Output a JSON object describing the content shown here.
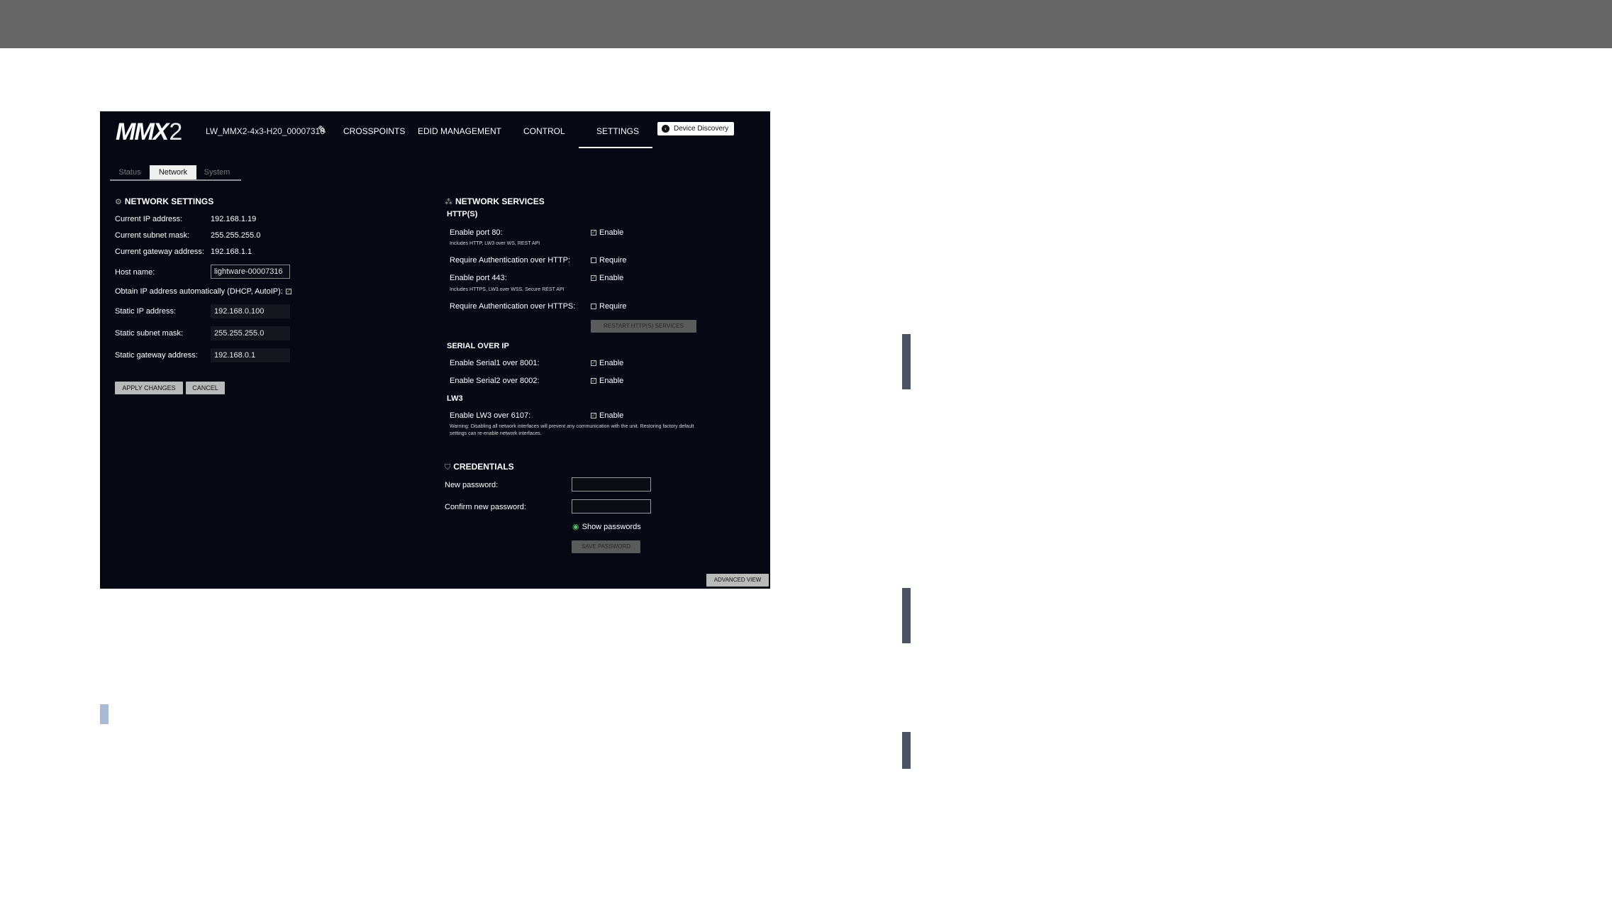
{
  "app": {
    "logo_main": "MMX",
    "logo_suffix": "2",
    "device_name": "LW_MMX2-4x3-H20_00007316",
    "nav": [
      "CROSSPOINTS",
      "EDID MANAGEMENT",
      "CONTROL",
      "SETTINGS"
    ],
    "active_nav": "SETTINGS",
    "device_discovery": "Device Discovery"
  },
  "subtabs": [
    "Status",
    "Network",
    "System"
  ],
  "active_subtab": "Network",
  "network_settings": {
    "title": "NETWORK SETTINGS",
    "current_ip_label": "Current IP address:",
    "current_ip": "192.168.1.19",
    "current_mask_label": "Current subnet mask:",
    "current_mask": "255.255.255.0",
    "current_gw_label": "Current gateway address:",
    "current_gw": "192.168.1.1",
    "hostname_label": "Host name:",
    "hostname": "lightware-00007316",
    "dhcp_label": "Obtain IP address automatically (DHCP, AutoIP):",
    "dhcp_checked": true,
    "static_ip_label": "Static IP address:",
    "static_ip": "192.168.0.100",
    "static_mask_label": "Static subnet mask:",
    "static_mask": "255.255.255.0",
    "static_gw_label": "Static gateway address:",
    "static_gw": "192.168.0.1",
    "apply": "APPLY CHANGES",
    "cancel": "CANCEL"
  },
  "network_services": {
    "title": "NETWORK SERVICES",
    "http_heading": "HTTP(S)",
    "port80_label": "Enable port 80:",
    "port80_note": "Includes HTTP, LW3 over WS, REST API",
    "port80_value": "Enable",
    "auth_http_label": "Require Authentication over HTTP:",
    "auth_http_value": "Require",
    "port443_label": "Enable port 443:",
    "port443_note": "Includes HTTPS, LW3 over WSS, Secure REST API",
    "port443_value": "Enable",
    "auth_https_label": "Require Authentication over HTTPS:",
    "auth_https_value": "Require",
    "restart": "RESTART HTTP(S) SERVICES",
    "serial_heading": "SERIAL OVER IP",
    "serial1_label": "Enable Serial1 over 8001:",
    "serial1_value": "Enable",
    "serial2_label": "Enable Serial2 over 8002:",
    "serial2_value": "Enable",
    "lw3_heading": "LW3",
    "lw3_label": "Enable LW3 over 6107:",
    "lw3_value": "Enable",
    "warning_line1": "Warning: Disabling all network interfaces will prevent any communication with the unit. Restoring factory default",
    "warning_line2": "settings can re-enable network interfaces."
  },
  "credentials": {
    "title": "CREDENTIALS",
    "new_pw_label": "New password:",
    "confirm_pw_label": "Confirm new password:",
    "show_passwords": "Show passwords",
    "save": "SAVE PASSWORD"
  },
  "advanced_view": "ADVANCED VIEW",
  "colors": {
    "panel_bg": "#060913",
    "top_band": "#666667",
    "checkmark": "#57c25c",
    "side_bar": "#4a5563",
    "left_mark": "#a9bad6"
  }
}
